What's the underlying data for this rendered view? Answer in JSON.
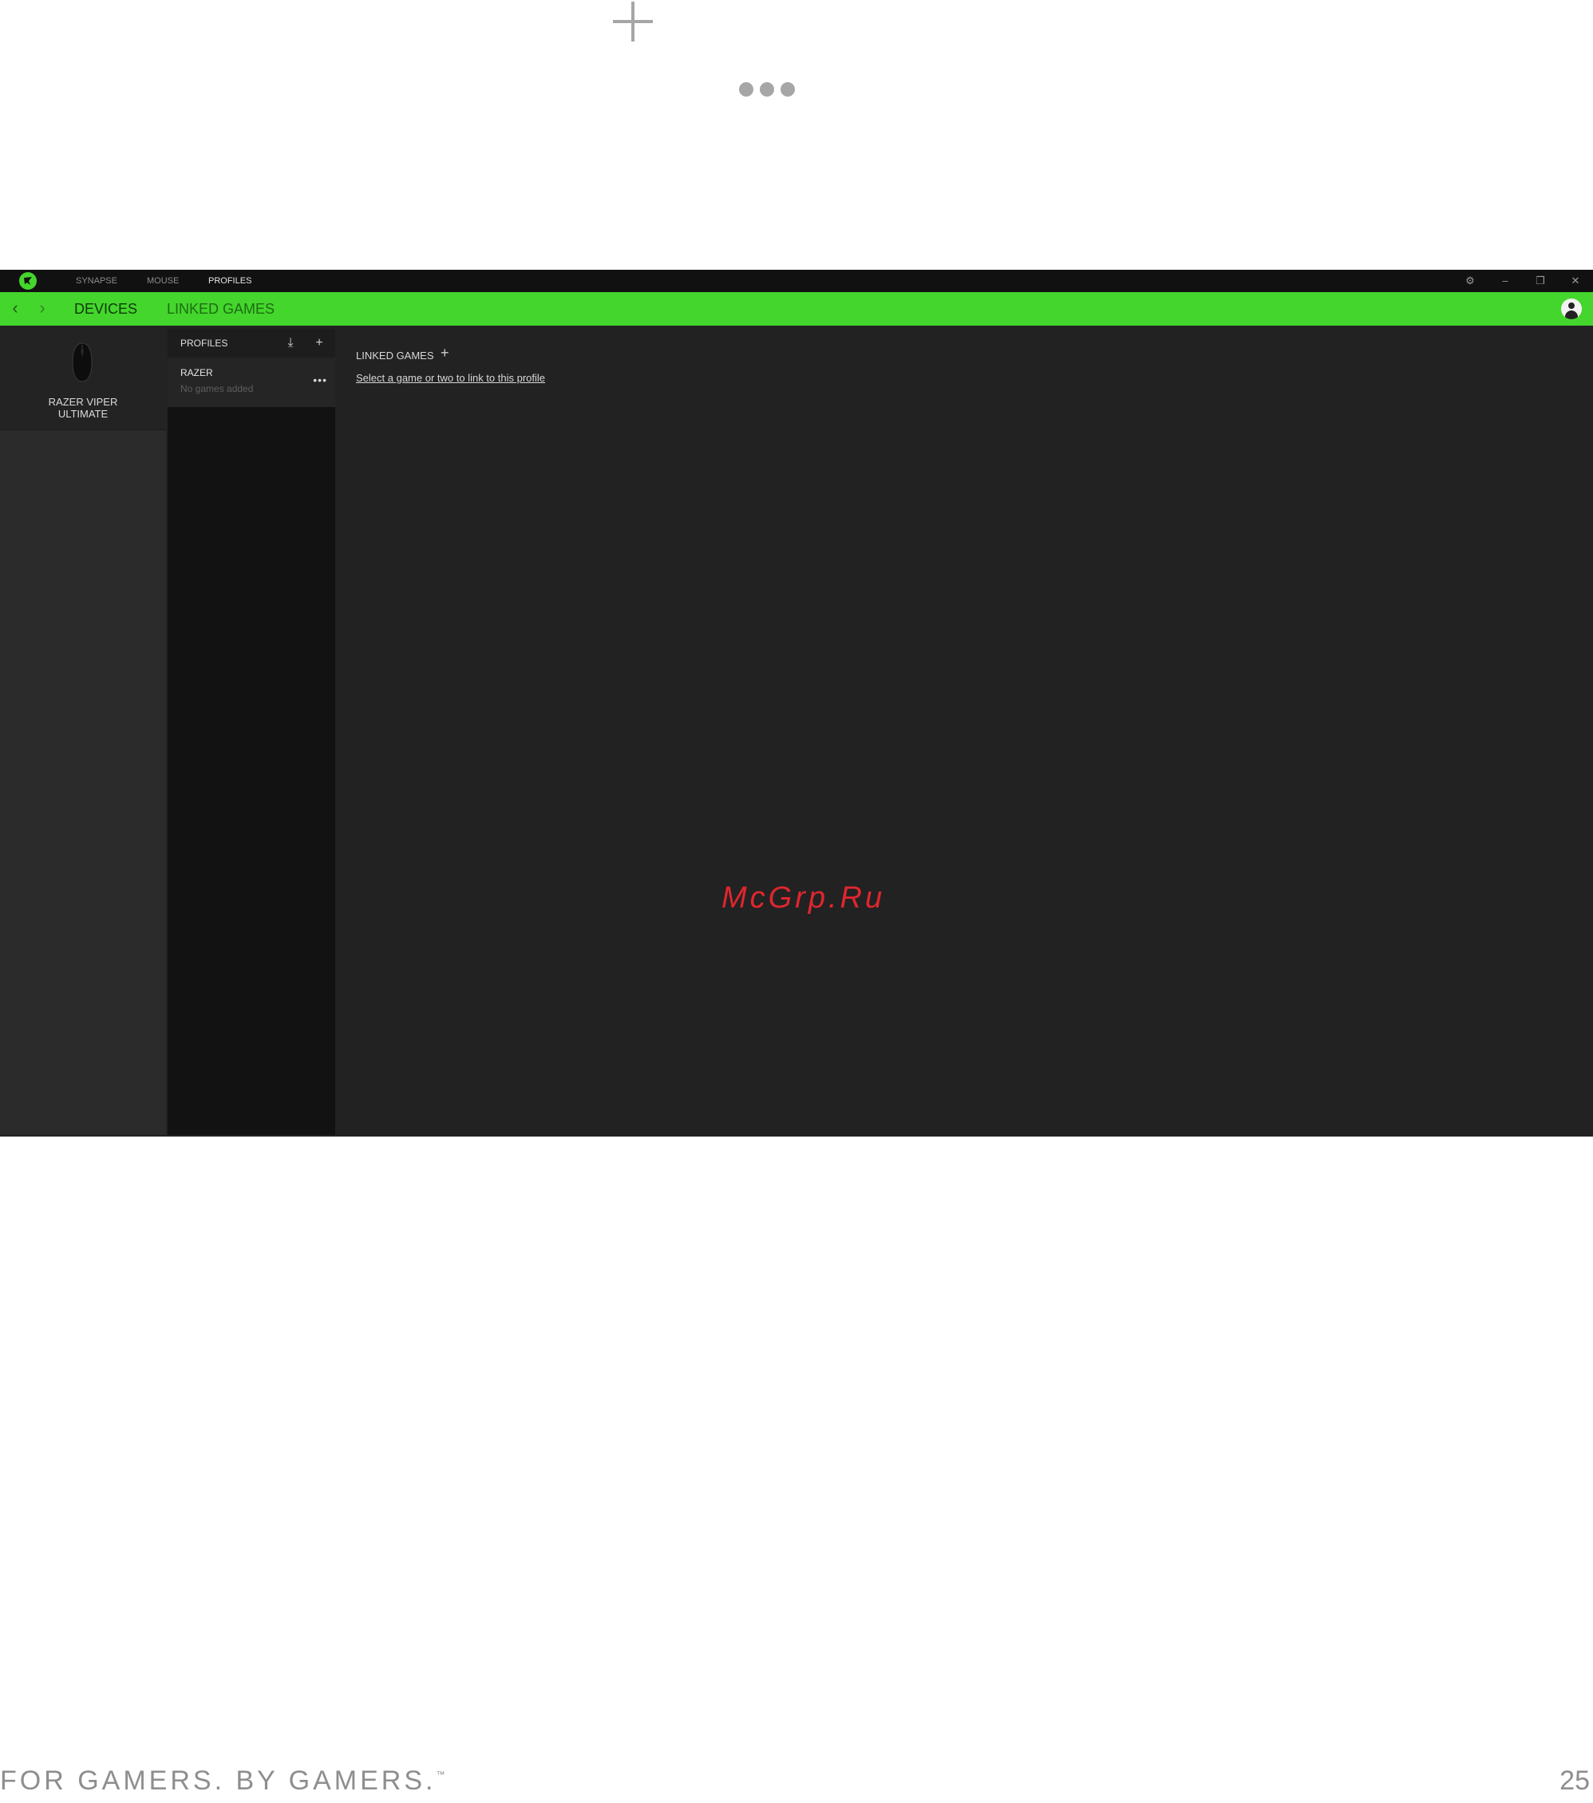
{
  "app": {
    "title_nav": [
      "SYNAPSE",
      "MOUSE",
      "PROFILES"
    ],
    "active_nav_index": 2,
    "window_controls": {
      "settings": "⚙",
      "minimize": "–",
      "restore": "❐",
      "close": "✕"
    },
    "subnav": {
      "back": "‹",
      "forward": "›",
      "tabs": [
        "DEVICES",
        "LINKED GAMES"
      ]
    },
    "device": {
      "name_line1": "RAZER VIPER",
      "name_line2": "ULTIMATE"
    },
    "profiles": {
      "header": "PROFILES",
      "import_icon": "⤓",
      "add_icon": "+",
      "items": [
        {
          "name": "RAZER",
          "subtitle": "No games added",
          "more": "•••"
        }
      ]
    },
    "linked_games": {
      "title": "LINKED GAMES",
      "add_icon": "+",
      "prompt": "Select a game or two to link to this profile"
    },
    "accent_color": "#44d62c"
  },
  "watermark": "McGrp.Ru",
  "footer": {
    "slogan": "FOR GAMERS. BY GAMERS.",
    "trademark": "™",
    "page_number": "25"
  }
}
